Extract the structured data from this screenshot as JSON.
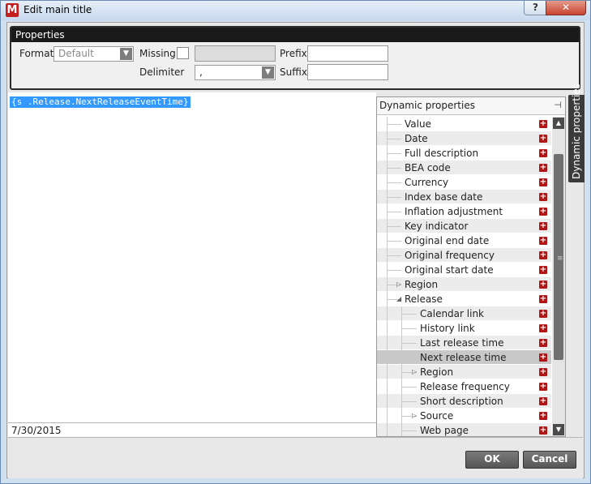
{
  "window": {
    "title": "Edit main title",
    "app_icon_letter": "M",
    "help_label": "?",
    "close_label": "✕"
  },
  "properties": {
    "header": "Properties",
    "format_label": "Format",
    "format_value": "Default",
    "missing_label": "Missing",
    "prefix_label": "Prefix",
    "prefix_value": "",
    "delimiter_label": "Delimiter",
    "delimiter_value": ",",
    "suffix_label": "Suffix",
    "suffix_value": ""
  },
  "editor": {
    "expression": "{s .Release.NextReleaseEventTime}",
    "preview": "7/30/2015"
  },
  "dynamic": {
    "header": "Dynamic properties",
    "side_tab": "Dynamic properties",
    "items": [
      {
        "label": "Value",
        "level": 1,
        "expander": "",
        "selected": false
      },
      {
        "label": "Date",
        "level": 1,
        "expander": "",
        "selected": false
      },
      {
        "label": "Full description",
        "level": 1,
        "expander": "",
        "selected": false
      },
      {
        "label": "BEA code",
        "level": 1,
        "expander": "",
        "selected": false
      },
      {
        "label": "Currency",
        "level": 1,
        "expander": "",
        "selected": false
      },
      {
        "label": "Index base date",
        "level": 1,
        "expander": "",
        "selected": false
      },
      {
        "label": "Inflation adjustment",
        "level": 1,
        "expander": "",
        "selected": false
      },
      {
        "label": "Key indicator",
        "level": 1,
        "expander": "",
        "selected": false
      },
      {
        "label": "Original end date",
        "level": 1,
        "expander": "",
        "selected": false
      },
      {
        "label": "Original frequency",
        "level": 1,
        "expander": "",
        "selected": false
      },
      {
        "label": "Original start date",
        "level": 1,
        "expander": "",
        "selected": false
      },
      {
        "label": "Region",
        "level": 1,
        "expander": "collapsed",
        "selected": false
      },
      {
        "label": "Release",
        "level": 1,
        "expander": "expanded",
        "selected": false
      },
      {
        "label": "Calendar link",
        "level": 2,
        "expander": "",
        "selected": false
      },
      {
        "label": "History link",
        "level": 2,
        "expander": "",
        "selected": false
      },
      {
        "label": "Last release time",
        "level": 2,
        "expander": "",
        "selected": false
      },
      {
        "label": "Next release time",
        "level": 2,
        "expander": "",
        "selected": true
      },
      {
        "label": "Region",
        "level": 2,
        "expander": "collapsed",
        "selected": false
      },
      {
        "label": "Release frequency",
        "level": 2,
        "expander": "",
        "selected": false
      },
      {
        "label": "Short description",
        "level": 2,
        "expander": "",
        "selected": false
      },
      {
        "label": "Source",
        "level": 2,
        "expander": "collapsed",
        "selected": false
      },
      {
        "label": "Web page",
        "level": 2,
        "expander": "",
        "selected": false
      }
    ]
  },
  "buttons": {
    "ok": "OK",
    "cancel": "Cancel"
  },
  "colors": {
    "accent_red": "#b01616",
    "selection": "#3399ff",
    "title_bar": "#c7d9ee"
  }
}
